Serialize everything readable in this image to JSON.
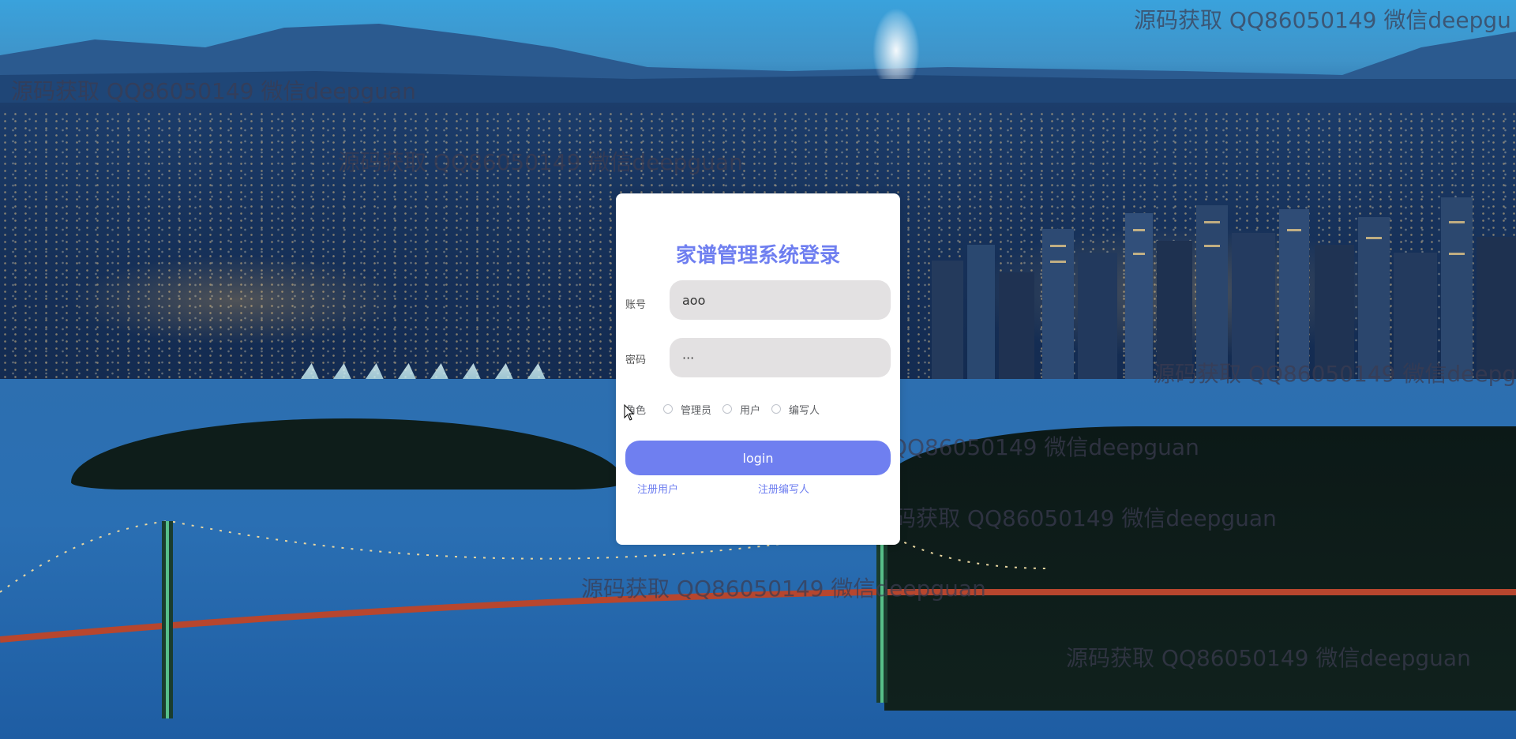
{
  "login": {
    "title": "家谱管理系统登录",
    "username_label": "账号",
    "username_value": "aoo",
    "password_label": "密码",
    "password_value": "···",
    "role_label": "角色",
    "roles": [
      "管理员",
      "用户",
      "编写人"
    ],
    "login_button": "login",
    "register_user": "注册用户",
    "register_writer": "注册编写人"
  },
  "watermark": {
    "text": "源码获取 QQ86050149 微信deepguan",
    "text_short": "源码获取 QQ86050149 微信deepgu"
  },
  "colors": {
    "accent": "#6f7ff0",
    "input_bg": "#e3e1e2"
  }
}
